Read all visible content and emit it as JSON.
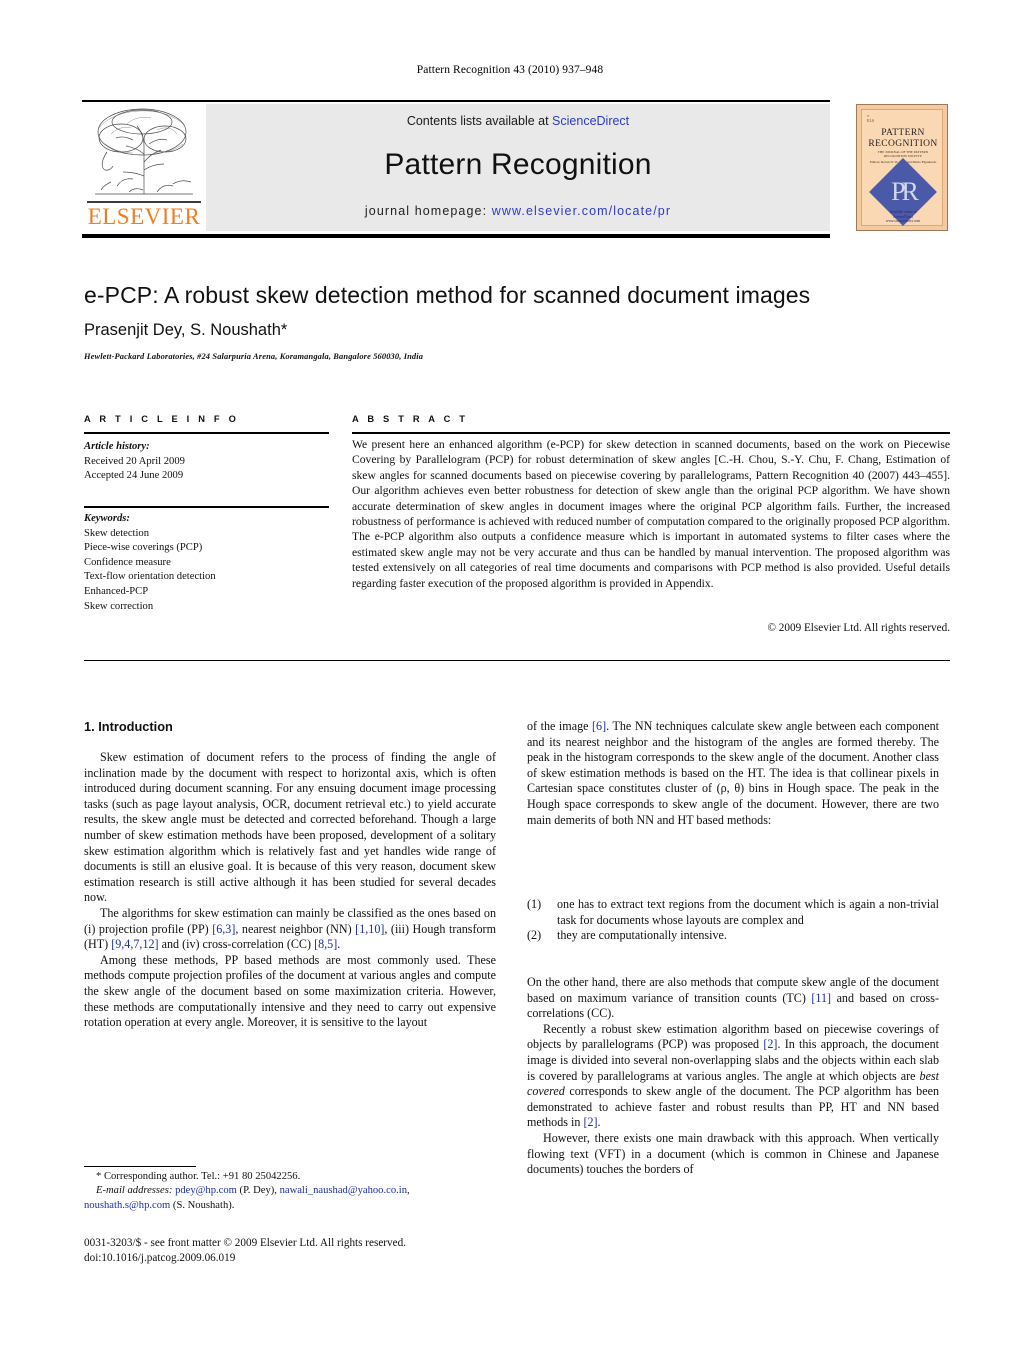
{
  "running_head": "Pattern Recognition 43 (2010) 937–948",
  "header": {
    "contents_prefix": "Contents lists available at ",
    "contents_link": "ScienceDirect",
    "journal_name": "Pattern Recognition",
    "homepage_prefix": "journal homepage: ",
    "homepage_url": "www.elsevier.com/locate/pr",
    "publisher_wordmark": "ELSEVIER",
    "link_color": "#2d3cc4",
    "band_color": "#e9e9e9",
    "elsevier_orange": "#ef7d22"
  },
  "cover": {
    "line1": "PATTERN",
    "line2": "RECOGNITION",
    "tagline": "THE JOURNAL OF THE PATTERN RECOGNITION SOCIETY",
    "editors": "Editors: Robert P. W. Duin and Mario Figueiredo",
    "monogram": "PR",
    "sciencedirect": "Available online at ScienceDirect www.sciencedirect.com",
    "bg_color": "#f7c9a0",
    "diamond_color": "#4a5aa8"
  },
  "article": {
    "title": "e-PCP: A robust skew detection method for scanned document images",
    "authors": "Prasenjit Dey, S. Noushath*",
    "affiliation": "Hewlett-Packard Laboratories, #24 Salarpuria Arena, Koramangala, Bangalore 560030, India"
  },
  "article_info": {
    "kicker": "A R T I C L E    I N F O",
    "history_label": "Article history:",
    "history": [
      "Received 20 April 2009",
      "Accepted 24 June 2009"
    ],
    "keywords_label": "Keywords:",
    "keywords": [
      "Skew detection",
      "Piece-wise coverings (PCP)",
      "Confidence measure",
      "Text-flow orientation detection",
      "Enhanced-PCP",
      "Skew correction"
    ]
  },
  "abstract": {
    "kicker": "A B S T R A C T",
    "text": "We present here an enhanced algorithm (e-PCP) for skew detection in scanned documents, based on the work on Piecewise Covering by Parallelogram (PCP) for robust determination of skew angles [C.-H. Chou, S.-Y. Chu, F. Chang, Estimation of skew angles for scanned documents based on piecewise covering by parallelograms, Pattern Recognition 40 (2007) 443–455]. Our algorithm achieves even better robustness for detection of skew angle than the original PCP algorithm. We have shown accurate determination of skew angles in document images where the original PCP algorithm fails. Further, the increased robustness of performance is achieved with reduced number of computation compared to the originally proposed PCP algorithm. The e-PCP algorithm also outputs a confidence measure which is important in automated systems to filter cases where the estimated skew angle may not be very accurate and thus can be handled by manual intervention. The proposed algorithm was tested extensively on all categories of real time documents and comparisons with PCP method is also provided. Useful details regarding faster execution of the proposed algorithm is provided in Appendix.",
    "copyright": "© 2009 Elsevier Ltd. All rights reserved."
  },
  "body": {
    "section_heading": "1. Introduction",
    "left_paragraphs": [
      "Skew estimation of document refers to the process of finding the angle of inclination made by the document with respect to horizontal axis, which is often introduced during document scanning. For any ensuing document image processing tasks (such as page layout analysis, OCR, document retrieval etc.) to yield accurate results, the skew angle must be detected and corrected beforehand. Though a large number of skew estimation methods have been proposed, development of a solitary skew estimation algorithm which is relatively fast and yet handles wide range of documents is still an elusive goal. It is because of this very reason, document skew estimation research is still active although it has been studied for several decades now.",
      "Among these methods, PP based methods are most commonly used. These methods compute projection profiles of the document at various angles and compute the skew angle of the document based on some maximization criteria. However, these methods are computationally intensive and they need to carry out expensive rotation operation at every angle. Moreover, it is sensitive to the layout"
    ],
    "left_classification": {
      "lead": "The algorithms for skew estimation can mainly be classified as the ones based on (i) projection profile (PP) ",
      "ref_pp": "[6,3]",
      "mid1": ", nearest neighbor (NN) ",
      "ref_nn": "[1,10]",
      "mid2": ", (iii) Hough transform (HT) ",
      "ref_ht": "[9,4,7,12]",
      "mid3": " and (iv) cross-correlation (CC) ",
      "ref_cc": "[8,5]",
      "tail": "."
    },
    "right_first": {
      "lead": "of the image ",
      "ref": "[6]",
      "tail": ". The NN techniques calculate skew angle between each component and its nearest neighbor and the histogram of the angles are formed thereby. The peak in the histogram corresponds to the skew angle of the document. Another class of skew estimation methods is based on the HT. The idea is that collinear pixels in Cartesian space constitutes cluster of (ρ, θ) bins in Hough space. The peak in the Hough space corresponds to skew angle of the document. However, there are two main demerits of both NN and HT based methods:"
    },
    "numbered_items": [
      {
        "num": "(1)",
        "text": "one has to extract text regions from the document which is again a non-trivial task for documents whose layouts are complex and"
      },
      {
        "num": "(2)",
        "text": "they are computationally intensive."
      }
    ],
    "right_tc": {
      "lead": "On the other hand, there are also methods that compute skew angle of the document based on maximum variance of transition counts (TC) ",
      "ref": "[11]",
      "tail": " and based on cross-correlations (CC)."
    },
    "right_pcp": {
      "lead": "Recently a robust skew estimation algorithm based on piecewise coverings of objects by parallelograms (PCP) was proposed ",
      "ref1": "[2]",
      "mid": ". In this approach, the document image is divided into several non-overlapping slabs and the objects within each slab is covered by parallelograms at various angles. The angle at which objects are ",
      "emph": "best covered",
      "mid2": " corresponds to skew angle of the document. The PCP algorithm has been demonstrated to achieve faster and robust results than PP, HT and NN based methods in ",
      "ref2": "[2]",
      "tail": "."
    },
    "right_last": "However, there exists one main drawback with this approach. When vertically flowing text (VFT) in a document (which is common in Chinese and Japanese documents) touches the borders of"
  },
  "footnotes": {
    "corresponding": "* Corresponding author. Tel.: +91 80 25042256.",
    "email_label": "E-mail addresses:",
    "email1": "pdey@hp.com",
    "email1_name": " (P. Dey), ",
    "email2": "nawali_naushad@yahoo.co.in",
    "email2_sep": ", ",
    "email3": "noushath.s@hp.com",
    "email3_name": " (S. Noushath).",
    "imprint_line1": "0031-3203/$ - see front matter © 2009 Elsevier Ltd. All rights reserved.",
    "imprint_line2": "doi:10.1016/j.patcog.2009.06.019"
  }
}
